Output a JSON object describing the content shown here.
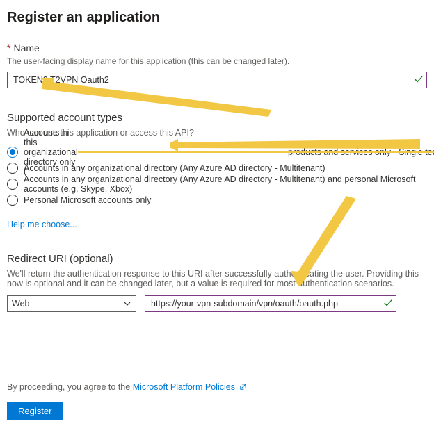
{
  "title": "Register an application",
  "name_section": {
    "label": "Name",
    "desc": "The user-facing display name for this application (this can be changed later).",
    "value": "TOKEN2 T2VPN Oauth2"
  },
  "account_types": {
    "title": "Supported account types",
    "desc": "Who can use this application or access this API?",
    "options": [
      "Accounts in this organizational directory only (",
      "Accounts in any organizational directory (Any Azure AD directory - Multitenant)",
      "Accounts in any organizational directory (Any Azure AD directory - Multitenant) and personal Microsoft accounts (e.g. Skype, Xbox)",
      "Personal Microsoft accounts only"
    ],
    "option0_struck": "                                                                                       products and services only - Single tenant)",
    "selected": 0,
    "help": "Help me choose..."
  },
  "redirect": {
    "title": "Redirect URI (optional)",
    "desc": "We'll return the authentication response to this URI after successfully authenticating the user. Providing this now is optional and it can be changed later, but a value is required for most authentication scenarios.",
    "platform": "Web",
    "uri": "https://your-vpn-subdomain/vpn/oauth/oauth.php"
  },
  "footer": {
    "policies_prefix": "By proceeding, you agree to the ",
    "policies_link": "Microsoft Platform Policies",
    "register": "Register"
  }
}
